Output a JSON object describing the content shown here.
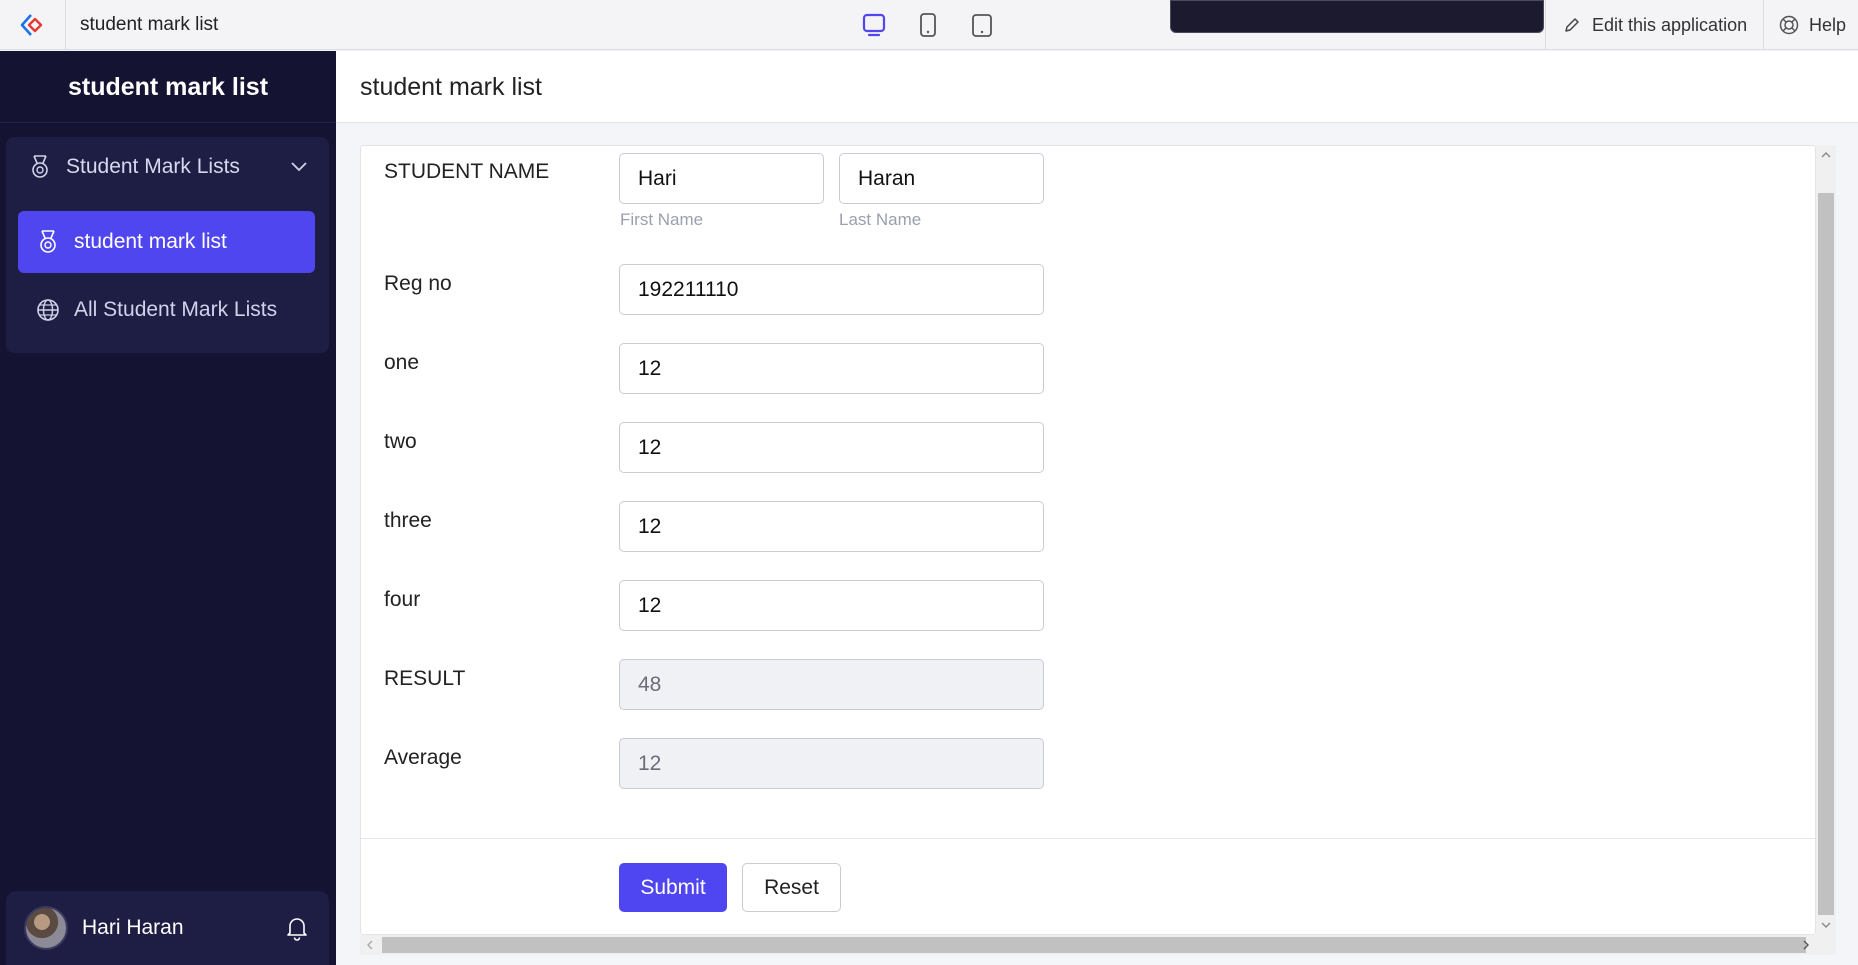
{
  "topbar": {
    "app_title": "student mark list",
    "edit_label": "Edit this application",
    "help_label": "Help"
  },
  "sidebar": {
    "header": "student mark list",
    "group_label": "Student Mark Lists",
    "items": [
      {
        "label": "student mark list",
        "active": true
      },
      {
        "label": "All Student Mark Lists",
        "active": false
      }
    ],
    "user_name": "Hari Haran"
  },
  "main": {
    "title": "student mark list"
  },
  "form": {
    "student_name_label": "STUDENT NAME",
    "first_name_value": "Hari",
    "first_name_hint": "First Name",
    "last_name_value": "Haran",
    "last_name_hint": "Last Name",
    "reg_no_label": "Reg no",
    "reg_no_value": "192211110",
    "one_label": "one",
    "one_value": "12",
    "two_label": "two",
    "two_value": "12",
    "three_label": "three",
    "three_value": "12",
    "four_label": "four",
    "four_value": "12",
    "result_label": "RESULT",
    "result_value": "48",
    "average_label": "Average",
    "average_value": "12",
    "submit_label": "Submit",
    "reset_label": "Reset"
  },
  "colors": {
    "accent": "#4f46f2",
    "sidebar_bg": "#141432"
  }
}
